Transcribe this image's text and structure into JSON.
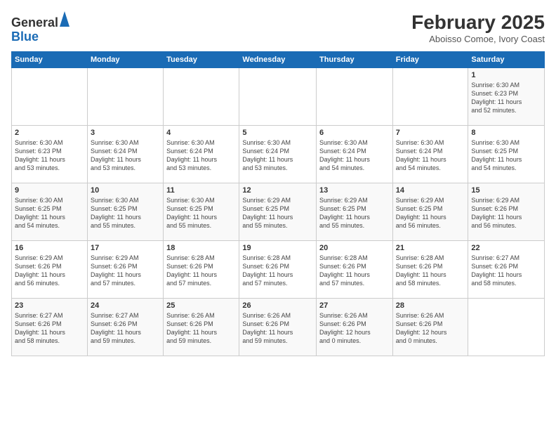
{
  "logo": {
    "general": "General",
    "blue": "Blue"
  },
  "header": {
    "title": "February 2025",
    "subtitle": "Aboisso Comoe, Ivory Coast"
  },
  "weekdays": [
    "Sunday",
    "Monday",
    "Tuesday",
    "Wednesday",
    "Thursday",
    "Friday",
    "Saturday"
  ],
  "weeks": [
    [
      {
        "day": "",
        "info": ""
      },
      {
        "day": "",
        "info": ""
      },
      {
        "day": "",
        "info": ""
      },
      {
        "day": "",
        "info": ""
      },
      {
        "day": "",
        "info": ""
      },
      {
        "day": "",
        "info": ""
      },
      {
        "day": "1",
        "info": "Sunrise: 6:30 AM\nSunset: 6:23 PM\nDaylight: 11 hours\nand 52 minutes."
      }
    ],
    [
      {
        "day": "2",
        "info": "Sunrise: 6:30 AM\nSunset: 6:23 PM\nDaylight: 11 hours\nand 53 minutes."
      },
      {
        "day": "3",
        "info": "Sunrise: 6:30 AM\nSunset: 6:24 PM\nDaylight: 11 hours\nand 53 minutes."
      },
      {
        "day": "4",
        "info": "Sunrise: 6:30 AM\nSunset: 6:24 PM\nDaylight: 11 hours\nand 53 minutes."
      },
      {
        "day": "5",
        "info": "Sunrise: 6:30 AM\nSunset: 6:24 PM\nDaylight: 11 hours\nand 53 minutes."
      },
      {
        "day": "6",
        "info": "Sunrise: 6:30 AM\nSunset: 6:24 PM\nDaylight: 11 hours\nand 54 minutes."
      },
      {
        "day": "7",
        "info": "Sunrise: 6:30 AM\nSunset: 6:24 PM\nDaylight: 11 hours\nand 54 minutes."
      },
      {
        "day": "8",
        "info": "Sunrise: 6:30 AM\nSunset: 6:25 PM\nDaylight: 11 hours\nand 54 minutes."
      }
    ],
    [
      {
        "day": "9",
        "info": "Sunrise: 6:30 AM\nSunset: 6:25 PM\nDaylight: 11 hours\nand 54 minutes."
      },
      {
        "day": "10",
        "info": "Sunrise: 6:30 AM\nSunset: 6:25 PM\nDaylight: 11 hours\nand 55 minutes."
      },
      {
        "day": "11",
        "info": "Sunrise: 6:30 AM\nSunset: 6:25 PM\nDaylight: 11 hours\nand 55 minutes."
      },
      {
        "day": "12",
        "info": "Sunrise: 6:29 AM\nSunset: 6:25 PM\nDaylight: 11 hours\nand 55 minutes."
      },
      {
        "day": "13",
        "info": "Sunrise: 6:29 AM\nSunset: 6:25 PM\nDaylight: 11 hours\nand 55 minutes."
      },
      {
        "day": "14",
        "info": "Sunrise: 6:29 AM\nSunset: 6:25 PM\nDaylight: 11 hours\nand 56 minutes."
      },
      {
        "day": "15",
        "info": "Sunrise: 6:29 AM\nSunset: 6:26 PM\nDaylight: 11 hours\nand 56 minutes."
      }
    ],
    [
      {
        "day": "16",
        "info": "Sunrise: 6:29 AM\nSunset: 6:26 PM\nDaylight: 11 hours\nand 56 minutes."
      },
      {
        "day": "17",
        "info": "Sunrise: 6:29 AM\nSunset: 6:26 PM\nDaylight: 11 hours\nand 57 minutes."
      },
      {
        "day": "18",
        "info": "Sunrise: 6:28 AM\nSunset: 6:26 PM\nDaylight: 11 hours\nand 57 minutes."
      },
      {
        "day": "19",
        "info": "Sunrise: 6:28 AM\nSunset: 6:26 PM\nDaylight: 11 hours\nand 57 minutes."
      },
      {
        "day": "20",
        "info": "Sunrise: 6:28 AM\nSunset: 6:26 PM\nDaylight: 11 hours\nand 57 minutes."
      },
      {
        "day": "21",
        "info": "Sunrise: 6:28 AM\nSunset: 6:26 PM\nDaylight: 11 hours\nand 58 minutes."
      },
      {
        "day": "22",
        "info": "Sunrise: 6:27 AM\nSunset: 6:26 PM\nDaylight: 11 hours\nand 58 minutes."
      }
    ],
    [
      {
        "day": "23",
        "info": "Sunrise: 6:27 AM\nSunset: 6:26 PM\nDaylight: 11 hours\nand 58 minutes."
      },
      {
        "day": "24",
        "info": "Sunrise: 6:27 AM\nSunset: 6:26 PM\nDaylight: 11 hours\nand 59 minutes."
      },
      {
        "day": "25",
        "info": "Sunrise: 6:26 AM\nSunset: 6:26 PM\nDaylight: 11 hours\nand 59 minutes."
      },
      {
        "day": "26",
        "info": "Sunrise: 6:26 AM\nSunset: 6:26 PM\nDaylight: 11 hours\nand 59 minutes."
      },
      {
        "day": "27",
        "info": "Sunrise: 6:26 AM\nSunset: 6:26 PM\nDaylight: 12 hours\nand 0 minutes."
      },
      {
        "day": "28",
        "info": "Sunrise: 6:26 AM\nSunset: 6:26 PM\nDaylight: 12 hours\nand 0 minutes."
      },
      {
        "day": "",
        "info": ""
      }
    ]
  ]
}
